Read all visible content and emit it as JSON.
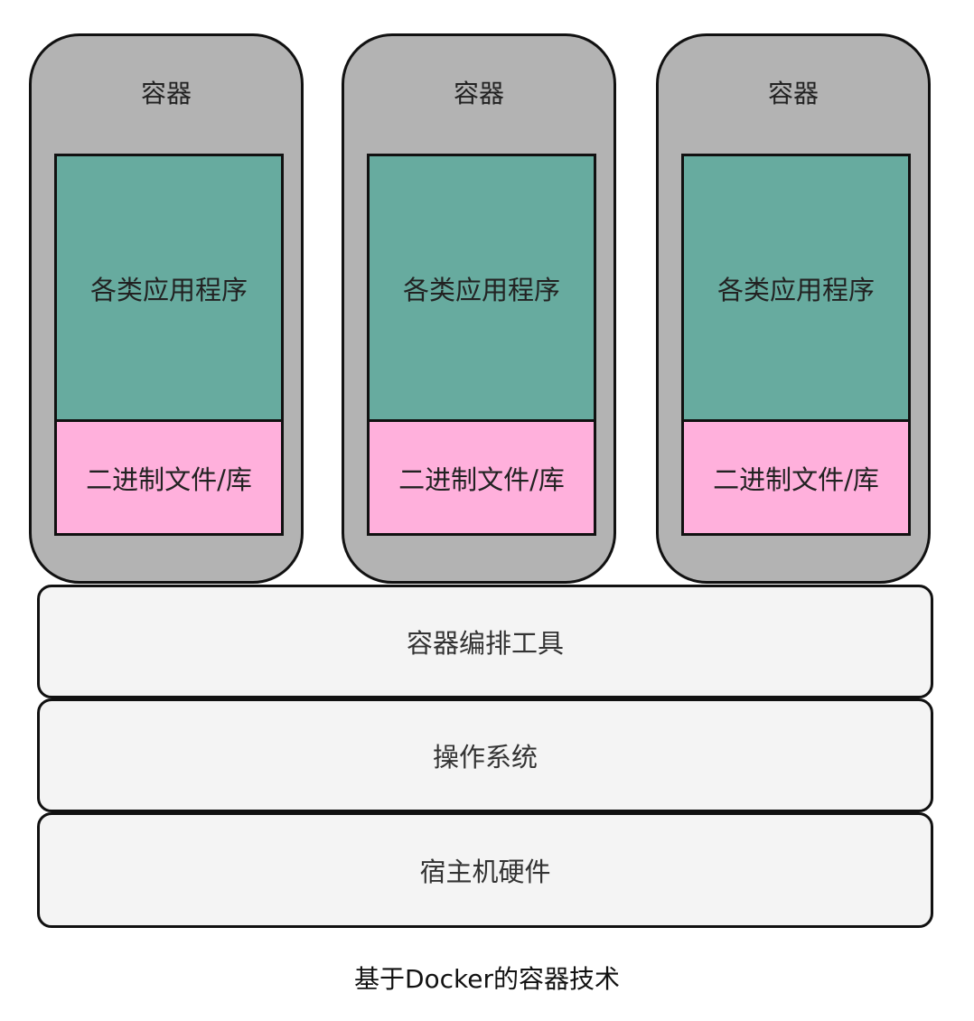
{
  "containers": [
    {
      "title": "容器",
      "app_label": "各类应用程序",
      "lib_label": "二进制文件/库"
    },
    {
      "title": "容器",
      "app_label": "各类应用程序",
      "lib_label": "二进制文件/库"
    },
    {
      "title": "容器",
      "app_label": "各类应用程序",
      "lib_label": "二进制文件/库"
    }
  ],
  "layers": {
    "orchestration": "容器编排工具",
    "os": "操作系统",
    "hardware": "宿主机硬件"
  },
  "caption": "基于Docker的容器技术",
  "colors": {
    "container_fill": "#b3b3b3",
    "app_fill": "#67ab9f",
    "lib_fill": "#ffb0dc",
    "layer_fill": "#f4f4f4",
    "stroke": "#111111"
  }
}
